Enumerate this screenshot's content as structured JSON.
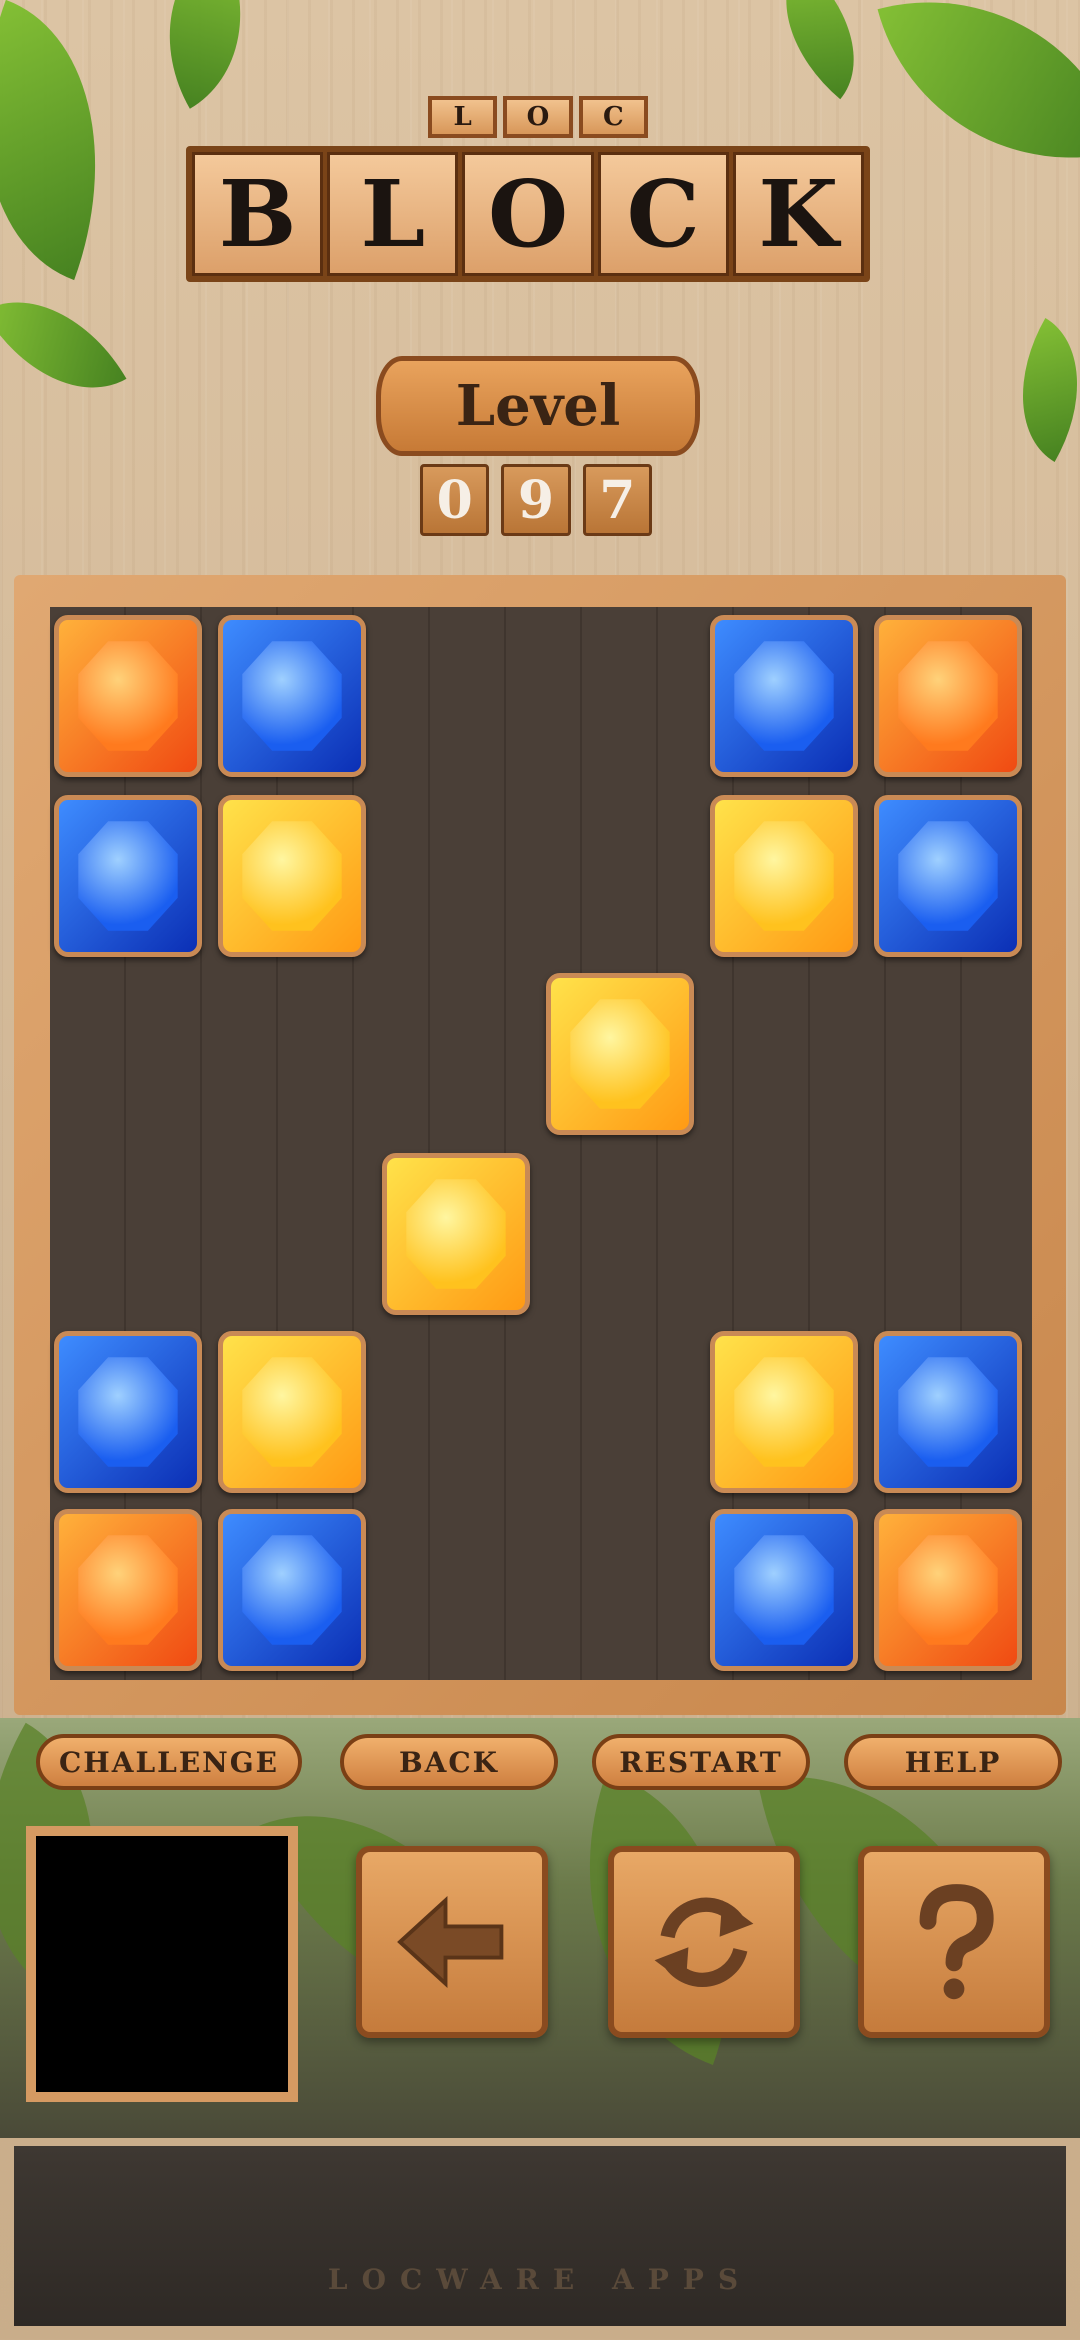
{
  "logo": {
    "small_letters": [
      "L",
      "O",
      "C"
    ],
    "main_letters": [
      "B",
      "L",
      "O",
      "C",
      "K"
    ]
  },
  "level": {
    "label": "Level",
    "digits": [
      "0",
      "9",
      "7"
    ]
  },
  "board": {
    "gems": [
      {
        "color": "orange"
      },
      {
        "color": "blue"
      },
      {
        "color": "blue"
      },
      {
        "color": "orange"
      },
      {
        "color": "blue"
      },
      {
        "color": "yellow"
      },
      {
        "color": "yellow"
      },
      {
        "color": "blue"
      },
      {
        "color": "yellow"
      },
      {
        "color": "yellow"
      },
      {
        "color": "blue"
      },
      {
        "color": "yellow"
      },
      {
        "color": "yellow"
      },
      {
        "color": "blue"
      },
      {
        "color": "orange"
      },
      {
        "color": "blue"
      },
      {
        "color": "blue"
      },
      {
        "color": "orange"
      }
    ]
  },
  "controls": {
    "challenge": "CHALLENGE",
    "back": "BACK",
    "restart": "RESTART",
    "help": "HELP",
    "icons": {
      "back": "arrow-left-icon",
      "restart": "refresh-icon",
      "help": "question-mark-icon"
    }
  },
  "footer": {
    "text": "LOCWARE APPS"
  },
  "colors": {
    "orange_gem": "#f06a1e",
    "blue_gem": "#1a5ef0",
    "yellow_gem": "#ffc21e",
    "wood": "#c77a36"
  }
}
